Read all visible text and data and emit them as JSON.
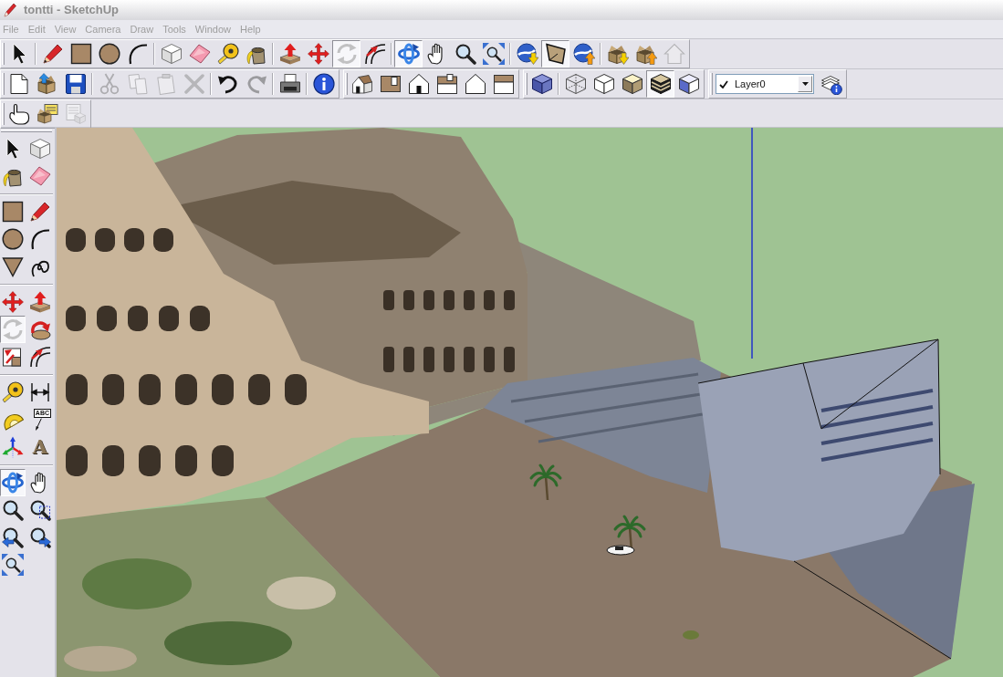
{
  "window": {
    "title": "tontti - SketchUp"
  },
  "menu": [
    "File",
    "Edit",
    "View",
    "Camera",
    "Draw",
    "Tools",
    "Window",
    "Help"
  ],
  "toolbar_rows": [
    [
      {
        "groups": [
          [
            {
              "kind": "select",
              "selected": false,
              "disabled": false
            }
          ],
          [
            {
              "kind": "pencil",
              "selected": false,
              "disabled": false
            },
            {
              "kind": "rectangle",
              "selected": false,
              "disabled": false
            },
            {
              "kind": "circle",
              "selected": false,
              "disabled": false
            },
            {
              "kind": "arc",
              "selected": false,
              "disabled": false
            }
          ],
          [
            {
              "kind": "component",
              "selected": false,
              "disabled": false
            },
            {
              "kind": "eraser",
              "selected": false,
              "disabled": false
            },
            {
              "kind": "tape",
              "selected": false,
              "disabled": false
            },
            {
              "kind": "paint",
              "selected": false,
              "disabled": false
            }
          ],
          [
            {
              "kind": "pushpull",
              "selected": false,
              "disabled": false
            },
            {
              "kind": "move",
              "selected": false,
              "disabled": false
            },
            {
              "kind": "cycle",
              "selected": true,
              "disabled": true
            },
            {
              "kind": "offset",
              "selected": false,
              "disabled": false
            }
          ],
          [
            {
              "kind": "orbit",
              "selected": true,
              "disabled": false
            },
            {
              "kind": "pan",
              "selected": false,
              "disabled": false
            },
            {
              "kind": "zoom",
              "selected": false,
              "disabled": false
            },
            {
              "kind": "zoomextents",
              "selected": false,
              "disabled": false
            }
          ],
          [
            {
              "kind": "getmodels",
              "selected": false,
              "disabled": false
            },
            {
              "kind": "terrain",
              "selected": true,
              "disabled": false
            },
            {
              "kind": "placemodel",
              "selected": false,
              "disabled": false
            }
          ],
          [
            {
              "kind": "getcomponent",
              "selected": false,
              "disabled": false
            },
            {
              "kind": "sharecomponent",
              "selected": false,
              "disabled": false
            },
            {
              "kind": "sharemodel",
              "selected": false,
              "disabled": true
            }
          ]
        ]
      }
    ],
    [
      {
        "groups": [
          [
            {
              "kind": "new",
              "selected": false,
              "disabled": false
            },
            {
              "kind": "open",
              "selected": false,
              "disabled": false
            },
            {
              "kind": "save",
              "selected": false,
              "disabled": false
            }
          ],
          [
            {
              "kind": "cut",
              "selected": false,
              "disabled": true
            },
            {
              "kind": "copy",
              "selected": false,
              "disabled": true
            },
            {
              "kind": "paste",
              "selected": false,
              "disabled": true
            },
            {
              "kind": "delete",
              "selected": false,
              "disabled": true
            }
          ],
          [
            {
              "kind": "undo",
              "selected": false,
              "disabled": false
            },
            {
              "kind": "redo",
              "selected": false,
              "disabled": true
            }
          ],
          [
            {
              "kind": "print",
              "selected": false,
              "disabled": false
            }
          ],
          [
            {
              "kind": "info",
              "selected": false,
              "disabled": false
            }
          ]
        ]
      },
      {
        "groups": [
          [
            {
              "kind": "iso",
              "selected": false,
              "disabled": false
            },
            {
              "kind": "top",
              "selected": false,
              "disabled": false
            },
            {
              "kind": "front",
              "selected": false,
              "disabled": false
            },
            {
              "kind": "right",
              "selected": false,
              "disabled": false
            },
            {
              "kind": "back",
              "selected": false,
              "disabled": false
            },
            {
              "kind": "left",
              "selected": false,
              "disabled": false
            }
          ]
        ]
      },
      {
        "groups": [
          [
            {
              "kind": "xray",
              "selected": false,
              "disabled": false
            }
          ],
          [
            {
              "kind": "wireframe",
              "selected": false,
              "disabled": false
            },
            {
              "kind": "hiddenline",
              "selected": false,
              "disabled": false
            },
            {
              "kind": "shaded",
              "selected": false,
              "disabled": false
            },
            {
              "kind": "textured",
              "selected": true,
              "disabled": false
            },
            {
              "kind": "monochrome",
              "selected": false,
              "disabled": false
            }
          ]
        ]
      },
      {
        "groups": [
          [
            {
              "kind": "layer",
              "value": "Layer0",
              "checked": true,
              "selected": false,
              "disabled": false
            },
            {
              "kind": "layermanager",
              "selected": false,
              "disabled": false
            }
          ]
        ]
      }
    ],
    [
      {
        "groups": [
          [
            {
              "kind": "interact",
              "selected": false,
              "disabled": false
            },
            {
              "kind": "dcattributes",
              "selected": false,
              "disabled": false
            },
            {
              "kind": "dcoptions",
              "selected": false,
              "disabled": true
            }
          ]
        ]
      }
    ]
  ],
  "side_toolbar": {
    "groups": [
      [
        {
          "kind": "select",
          "selected": false,
          "disabled": false
        },
        {
          "kind": "component",
          "selected": false,
          "disabled": false
        },
        {
          "kind": "paint",
          "selected": false,
          "disabled": false
        },
        {
          "kind": "eraser",
          "selected": false,
          "disabled": false
        }
      ],
      [
        {
          "kind": "rectangle",
          "selected": false,
          "disabled": false
        },
        {
          "kind": "pencil",
          "selected": false,
          "disabled": false
        },
        {
          "kind": "circle",
          "selected": false,
          "disabled": false
        },
        {
          "kind": "arc",
          "selected": false,
          "disabled": false
        },
        {
          "kind": "polygon",
          "selected": false,
          "disabled": false
        },
        {
          "kind": "freehand",
          "selected": false,
          "disabled": false
        }
      ],
      [
        {
          "kind": "move",
          "selected": false,
          "disabled": false
        },
        {
          "kind": "pushpull",
          "selected": false,
          "disabled": false
        },
        {
          "kind": "cycle",
          "selected": true,
          "disabled": true
        },
        {
          "kind": "rotate",
          "selected": false,
          "disabled": false
        },
        {
          "kind": "scale",
          "selected": false,
          "disabled": false
        },
        {
          "kind": "offset",
          "selected": false,
          "disabled": false
        }
      ],
      [
        {
          "kind": "tape",
          "selected": false,
          "disabled": false
        },
        {
          "kind": "dimension",
          "selected": false,
          "disabled": false
        },
        {
          "kind": "protractor",
          "selected": false,
          "disabled": false
        },
        {
          "kind": "text",
          "label": "ABC",
          "selected": false,
          "disabled": false
        },
        {
          "kind": "axes",
          "selected": false,
          "disabled": false
        },
        {
          "kind": "text3d",
          "label": "A",
          "selected": false,
          "disabled": false
        }
      ],
      [
        {
          "kind": "orbit",
          "selected": true,
          "disabled": false
        },
        {
          "kind": "pan",
          "selected": false,
          "disabled": false
        },
        {
          "kind": "zoom",
          "selected": false,
          "disabled": false
        },
        {
          "kind": "zoomwindow",
          "selected": false,
          "disabled": false
        },
        {
          "kind": "previous",
          "selected": false,
          "disabled": false
        },
        {
          "kind": "next",
          "selected": false,
          "disabled": false
        },
        {
          "kind": "zoomextents",
          "selected": false,
          "disabled": false
        }
      ]
    ]
  }
}
